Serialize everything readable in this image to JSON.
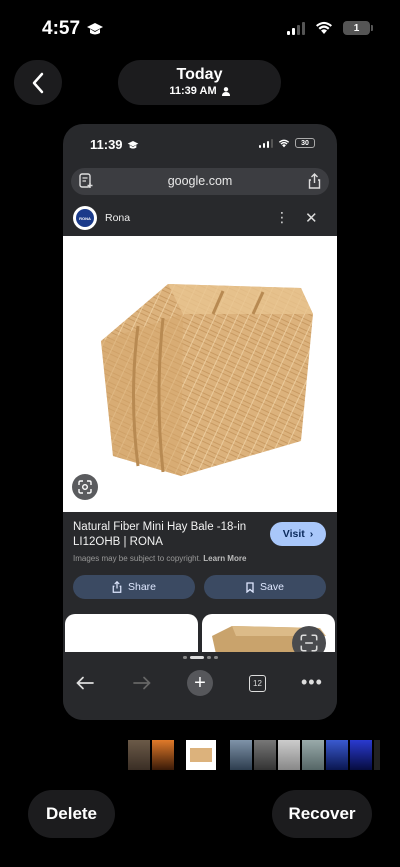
{
  "status_bar": {
    "time": "4:57",
    "battery": "1"
  },
  "header": {
    "title": "Today",
    "subtitle": "11:39 AM"
  },
  "inner_screen": {
    "status_time": "11:39",
    "battery": "30",
    "url": "google.com",
    "source_name": "Rona",
    "source_logo_text": "RONA",
    "caption": "Natural Fiber Mini Hay Bale -18-in LI12OHB | RONA",
    "copyright_note": "Images may be subject to copyright.",
    "learn_more": "Learn More",
    "visit_label": "Visit",
    "share_label": "Share",
    "save_label": "Save",
    "tab_count": "12"
  },
  "actions": {
    "delete_label": "Delete",
    "recover_label": "Recover"
  },
  "colors": {
    "visit_bg": "#a9c7fa",
    "pill_bg": "#1c1c1e",
    "card_bg": "#28292c"
  }
}
